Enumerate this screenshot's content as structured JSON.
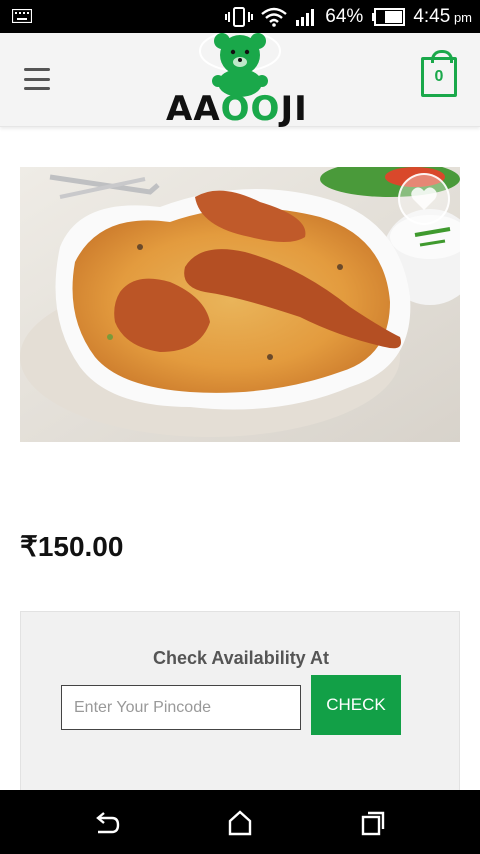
{
  "status_bar": {
    "battery": "64%",
    "time": "4:45",
    "ampm": "pm",
    "icons": [
      "keyboard-icon",
      "vibrate-icon",
      "wifi-icon",
      "signal-icon",
      "battery-icon"
    ]
  },
  "header": {
    "logo_text_1": "AA",
    "logo_text_2": "OO",
    "logo_text_3": "JI",
    "cart_count": "0",
    "brand_color": "#1aa84a"
  },
  "product": {
    "image_icon": "biryani-photo",
    "price": "₹150.00"
  },
  "availability": {
    "title": "Check Availability At",
    "placeholder": "Enter Your Pincode",
    "value": "",
    "button_label": "CHECK",
    "button_color": "#12a047"
  },
  "nav_bar": {
    "icons": [
      "back-icon",
      "home-icon",
      "recents-icon"
    ]
  }
}
